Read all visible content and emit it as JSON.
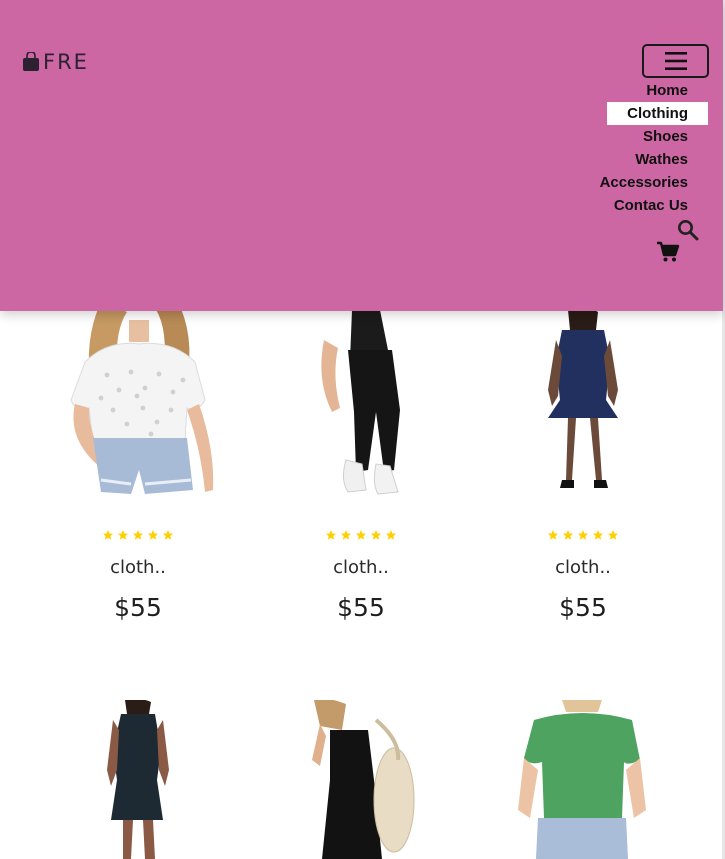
{
  "brand": {
    "name": "FRE"
  },
  "nav": {
    "items": [
      {
        "label": "Home",
        "active": false
      },
      {
        "label": "Clothing",
        "active": true
      },
      {
        "label": "Shoes",
        "active": false
      },
      {
        "label": "Wathes",
        "active": false
      },
      {
        "label": "Accessories",
        "active": false
      },
      {
        "label": "Contac Us",
        "active": false
      }
    ]
  },
  "icons": {
    "toggler": "hamburger-icon",
    "search": "search-icon",
    "cart": "cart-icon",
    "bag": "shopping-bag-icon",
    "star": "star-icon"
  },
  "colors": {
    "header_bg": "#cd67a4",
    "star": "#ffd000",
    "active_nav_bg": "#ffffff"
  },
  "products": [
    {
      "name": "cloth..",
      "price": "$55",
      "rating": 5,
      "image": "woman-white-eyelet-blouse-denim-shorts"
    },
    {
      "name": "cloth..",
      "price": "$55",
      "rating": 5,
      "image": "woman-black-joggers"
    },
    {
      "name": "cloth..",
      "price": "$55",
      "rating": 5,
      "image": "woman-navy-lace-dress"
    },
    {
      "name": "",
      "price": "",
      "rating": 0,
      "image": "woman-dark-sleeveless-bodycon-dress"
    },
    {
      "name": "",
      "price": "",
      "rating": 0,
      "image": "woman-black-tank-dress-tote"
    },
    {
      "name": "",
      "price": "",
      "rating": 0,
      "image": "woman-green-knit-top"
    }
  ]
}
